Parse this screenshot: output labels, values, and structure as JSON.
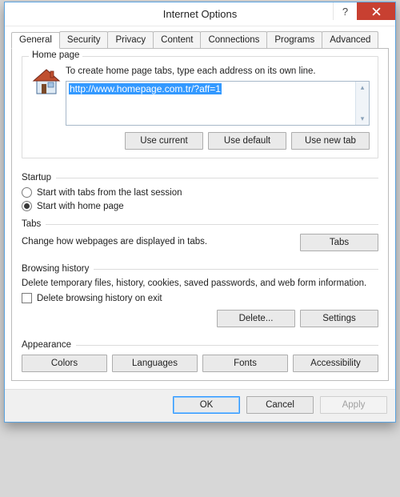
{
  "title": "Internet Options",
  "tabs": [
    "General",
    "Security",
    "Privacy",
    "Content",
    "Connections",
    "Programs",
    "Advanced"
  ],
  "active_tab": 0,
  "home_page": {
    "legend": "Home page",
    "hint": "To create home page tabs, type each address on its own line.",
    "url_value": "http://www.homepage.com.tr/?aff=1",
    "buttons": {
      "use_current": "Use current",
      "use_default": "Use default",
      "use_new_tab": "Use new tab"
    }
  },
  "startup": {
    "legend": "Startup",
    "opt_last": "Start with tabs from the last session",
    "opt_home": "Start with home page",
    "selected": "home"
  },
  "tabs_section": {
    "legend": "Tabs",
    "desc": "Change how webpages are displayed in tabs.",
    "button": "Tabs"
  },
  "history": {
    "legend": "Browsing history",
    "desc": "Delete temporary files, history, cookies, saved passwords, and web form information.",
    "checkbox": "Delete browsing history on exit",
    "checked": false,
    "delete_btn": "Delete...",
    "settings_btn": "Settings"
  },
  "appearance": {
    "legend": "Appearance",
    "colors": "Colors",
    "languages": "Languages",
    "fonts": "Fonts",
    "accessibility": "Accessibility"
  },
  "footer": {
    "ok": "OK",
    "cancel": "Cancel",
    "apply": "Apply"
  }
}
